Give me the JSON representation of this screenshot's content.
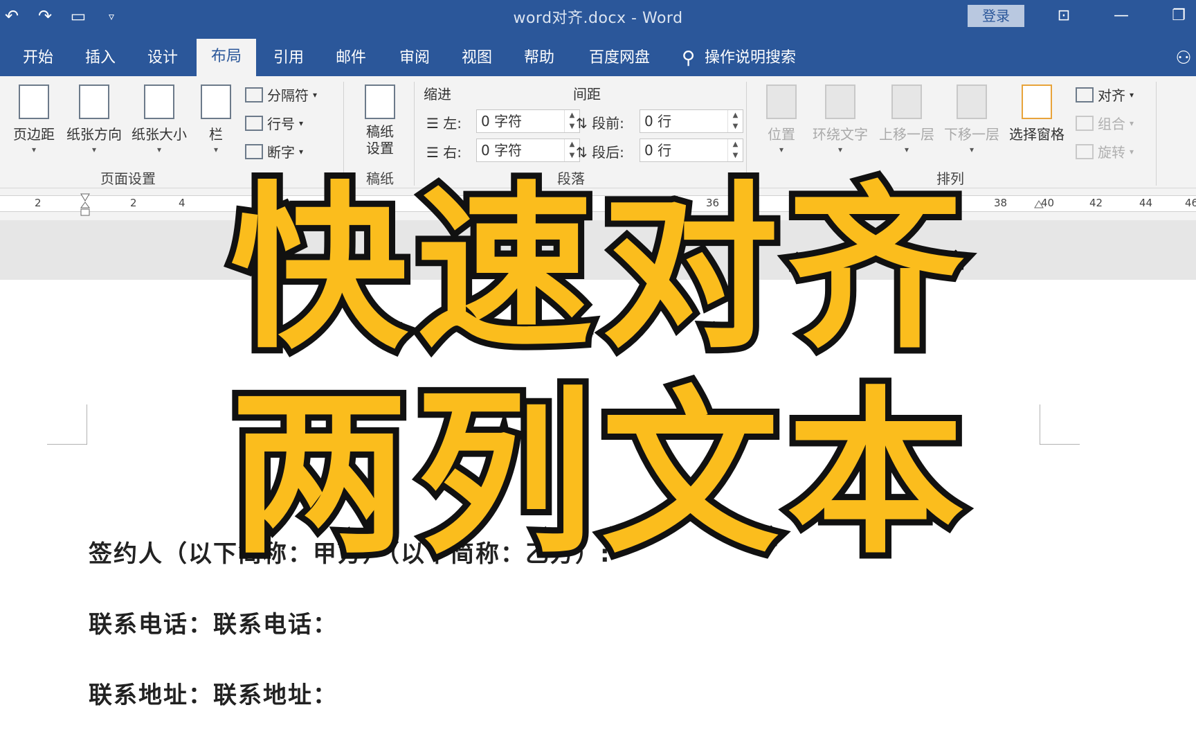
{
  "window": {
    "title": "word对齐.docx  -  Word",
    "login_label": "登录"
  },
  "quick_access": [
    "undo-icon",
    "redo-icon",
    "window-icon",
    "customize-icon"
  ],
  "tabs": [
    {
      "label": "开始",
      "active": false
    },
    {
      "label": "插入",
      "active": false
    },
    {
      "label": "设计",
      "active": false
    },
    {
      "label": "布局",
      "active": true
    },
    {
      "label": "引用",
      "active": false
    },
    {
      "label": "邮件",
      "active": false
    },
    {
      "label": "审阅",
      "active": false
    },
    {
      "label": "视图",
      "active": false
    },
    {
      "label": "帮助",
      "active": false
    },
    {
      "label": "百度网盘",
      "active": false
    }
  ],
  "tell_me": "操作说明搜索",
  "ribbon": {
    "page_setup": {
      "margins": "页边距",
      "orientation": "纸张方向",
      "size": "纸张大小",
      "columns": "栏",
      "breaks": "分隔符",
      "line_numbers": "行号",
      "hyphenation": "断字",
      "group_label": "页面设置"
    },
    "draft": {
      "button": "稿纸\n设置",
      "group_label": "稿纸"
    },
    "paragraph": {
      "indent_title": "缩进",
      "spacing_title": "间距",
      "left_label": "左:",
      "right_label": "右:",
      "left_value": "0 字符",
      "right_value": "0 字符",
      "before_label": "段前:",
      "after_label": "段后:",
      "before_value": "0 行",
      "after_value": "0 行",
      "group_label": "段落"
    },
    "arrange": {
      "position": "位置",
      "wrap_text": "环绕文字",
      "bring_forward": "上移一层",
      "send_backward": "下移一层",
      "selection_pane": "选择窗格",
      "align": "对齐",
      "group": "组合",
      "rotate": "旋转",
      "group_label": "排列"
    }
  },
  "ruler": {
    "left_numbers": [
      "2",
      "2",
      "4"
    ],
    "right_numbers": [
      "36",
      "38",
      "40",
      "42",
      "44",
      "46"
    ]
  },
  "document": {
    "lines": [
      "签约人（以下简称：甲方）（以下简称：乙方）:",
      "联系电话：联系电话：",
      "联系地址：联系地址："
    ]
  },
  "overlay": {
    "line1": "快速对齐",
    "line2": "两列文本",
    "color": "#fbbd1d"
  },
  "colors": {
    "accent": "#2b579a",
    "ribbon_bg": "#f3f3f3"
  }
}
